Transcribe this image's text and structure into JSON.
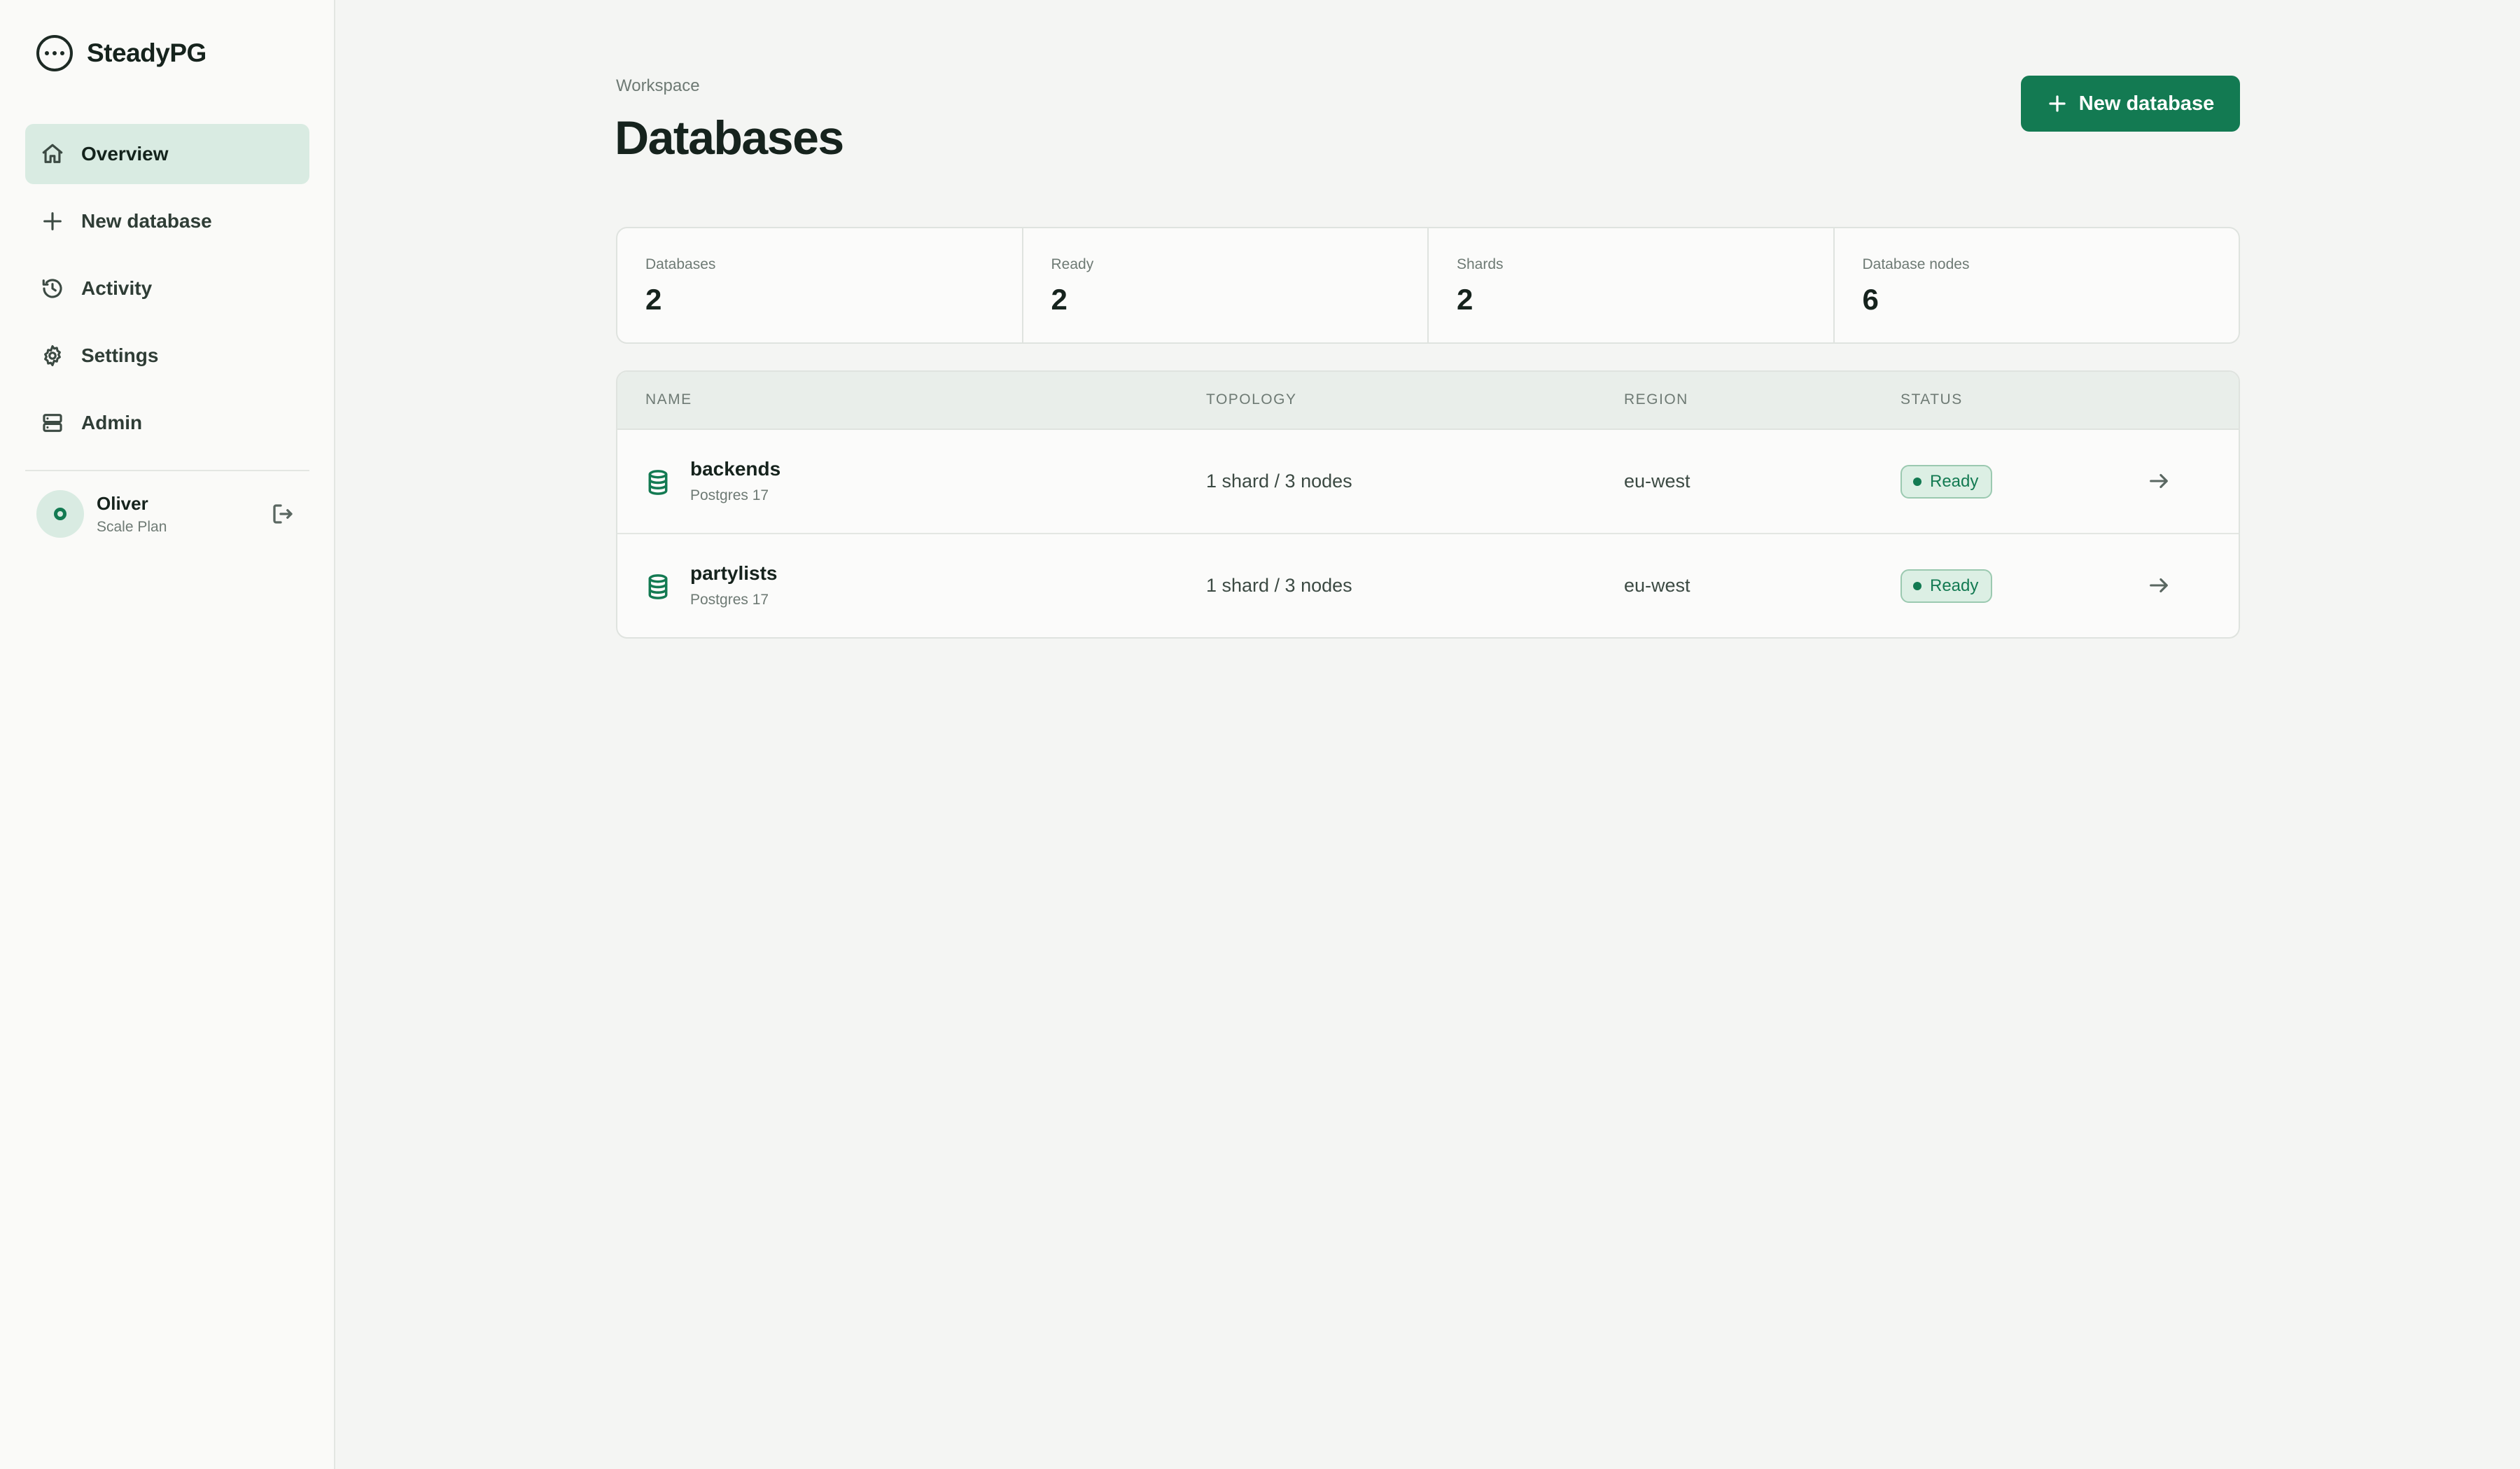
{
  "brand": {
    "name": "SteadyPG",
    "icon": "steadypg-logo-icon"
  },
  "sidebar": {
    "items": [
      {
        "label": "Overview",
        "icon": "home-icon",
        "active": true
      },
      {
        "label": "New database",
        "icon": "plus-icon",
        "active": false
      },
      {
        "label": "Activity",
        "icon": "history-icon",
        "active": false
      },
      {
        "label": "Settings",
        "icon": "gear-icon",
        "active": false
      },
      {
        "label": "Admin",
        "icon": "server-icon",
        "active": false
      }
    ],
    "user": {
      "name": "Oliver",
      "plan": "Scale Plan",
      "logout_icon": "logout-icon"
    }
  },
  "header": {
    "breadcrumb": "Workspace",
    "title": "Databases",
    "new_button_label": "New database"
  },
  "stats": [
    {
      "label": "Databases",
      "value": "2"
    },
    {
      "label": "Ready",
      "value": "2"
    },
    {
      "label": "Shards",
      "value": "2"
    },
    {
      "label": "Database nodes",
      "value": "6"
    }
  ],
  "table": {
    "columns": [
      "NAME",
      "TOPOLOGY",
      "REGION",
      "STATUS"
    ],
    "rows": [
      {
        "name": "backends",
        "version": "Postgres 17",
        "topology": "1 shard / 3 nodes",
        "region": "eu-west",
        "status": "Ready"
      },
      {
        "name": "partylists",
        "version": "Postgres 17",
        "topology": "1 shard / 3 nodes",
        "region": "eu-west",
        "status": "Ready"
      }
    ]
  },
  "colors": {
    "accent": "#137a52",
    "active_nav_bg": "#d9ebe2",
    "badge_bg": "#dcefe4"
  }
}
